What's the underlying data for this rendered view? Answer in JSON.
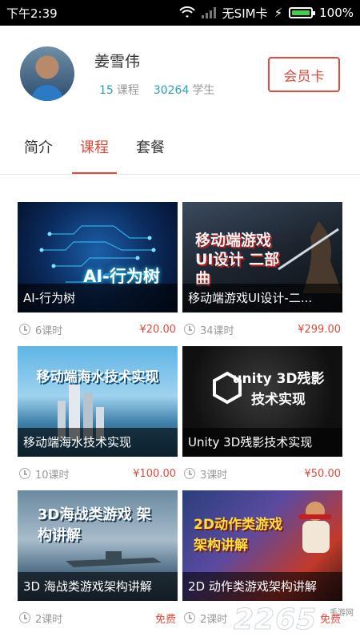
{
  "status": {
    "time": "下午2:39",
    "carrier": "无SIM卡",
    "battery": "100%"
  },
  "profile": {
    "name": "姜雪伟",
    "course_count": "15",
    "course_label": "课程",
    "student_count": "30264",
    "student_label": "学生",
    "member_button": "会员卡"
  },
  "tabs": [
    {
      "label": "简介"
    },
    {
      "label": "课程"
    },
    {
      "label": "套餐"
    }
  ],
  "courses": [
    {
      "title": "AI-行为树",
      "art": "AI-行为树",
      "lessons": "6课时",
      "price": "¥20.00"
    },
    {
      "title": "移动端游戏UI设计-二...",
      "art": "移动端游戏 UI设计 二部曲",
      "lessons": "34课时",
      "price": "¥299.00"
    },
    {
      "title": "移动端海水技术实现",
      "art": "移动端海水技术实现",
      "lessons": "10课时",
      "price": "¥100.00"
    },
    {
      "title": "Unity 3D残影技术实现",
      "art": "unity 3D残影技术实现",
      "lessons": "3课时",
      "price": "¥50.00"
    },
    {
      "title": "3D 海战类游戏架构讲解",
      "art": "3D海战类游戏 架构讲解",
      "lessons": "2课时",
      "price": "免费"
    },
    {
      "title": "2D 动作类游戏架构讲解",
      "art": "2D动作类游戏 架构讲解",
      "lessons": "2课时",
      "price": "免费"
    }
  ],
  "watermark": {
    "number": "2265",
    "site": "手游网"
  },
  "colors": {
    "accent": "#e24a3b",
    "stat": "#2aa0b8"
  },
  "icons": {
    "wifi": "wifi-icon",
    "signal": "signal-icon",
    "battery": "battery-icon",
    "clock": "clock-icon"
  }
}
